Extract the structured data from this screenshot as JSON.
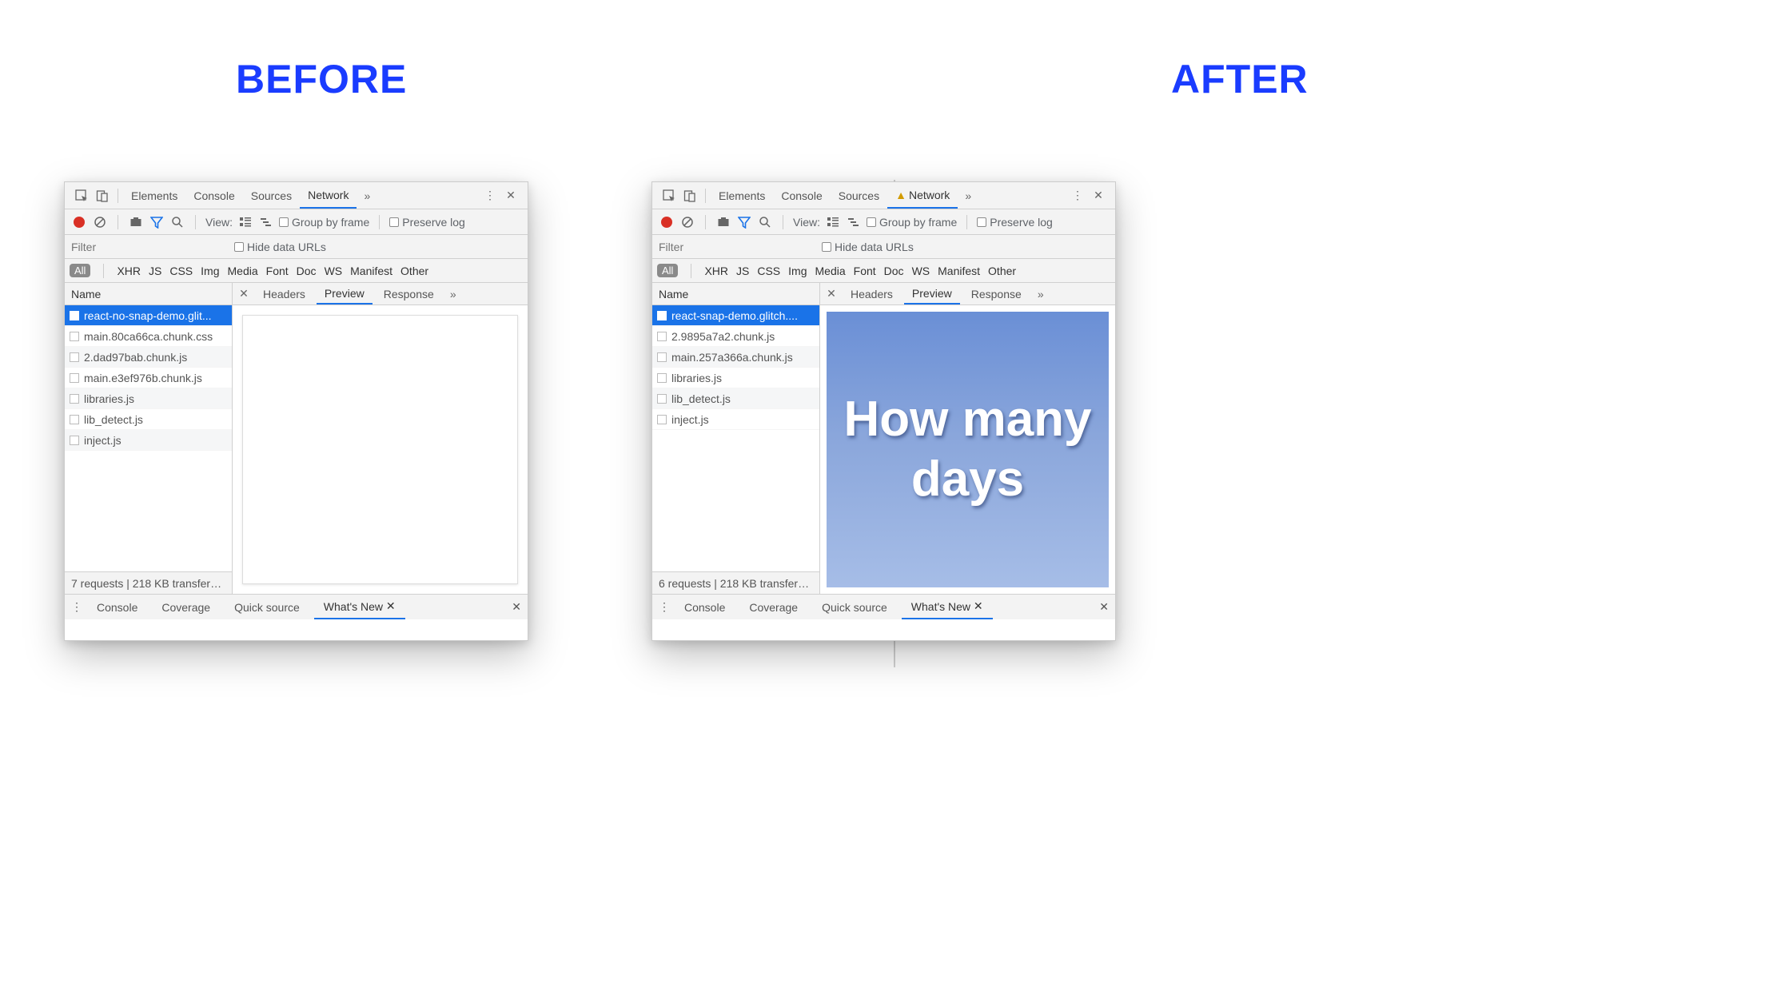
{
  "headings": {
    "before": "BEFORE",
    "after": "AFTER"
  },
  "top_tabs": {
    "elements": "Elements",
    "console": "Console",
    "sources": "Sources",
    "network": "Network"
  },
  "toolbar": {
    "view": "View:",
    "group_by_frame": "Group by frame",
    "preserve_log": "Preserve log"
  },
  "filter": {
    "placeholder": "Filter",
    "hide_data_urls": "Hide data URLs"
  },
  "types": {
    "all": "All",
    "xhr": "XHR",
    "js": "JS",
    "css": "CSS",
    "img": "Img",
    "media": "Media",
    "font": "Font",
    "doc": "Doc",
    "ws": "WS",
    "manifest": "Manifest",
    "other": "Other"
  },
  "columns": {
    "name": "Name"
  },
  "right_tabs": {
    "headers": "Headers",
    "preview": "Preview",
    "response": "Response"
  },
  "drawer": {
    "console": "Console",
    "coverage": "Coverage",
    "quick_source": "Quick source",
    "whats_new": "What's New"
  },
  "before_panel": {
    "has_warning": false,
    "requests": [
      "react-no-snap-demo.glit...",
      "main.80ca66ca.chunk.css",
      "2.dad97bab.chunk.js",
      "main.e3ef976b.chunk.js",
      "libraries.js",
      "lib_detect.js",
      "inject.js"
    ],
    "summary": "7 requests | 218 KB transfer…",
    "preview_text": ""
  },
  "after_panel": {
    "has_warning": true,
    "requests": [
      "react-snap-demo.glitch....",
      "2.9895a7a2.chunk.js",
      "main.257a366a.chunk.js",
      "libraries.js",
      "lib_detect.js",
      "inject.js"
    ],
    "summary": "6 requests | 218 KB transfer…",
    "preview_text": "How many days"
  }
}
